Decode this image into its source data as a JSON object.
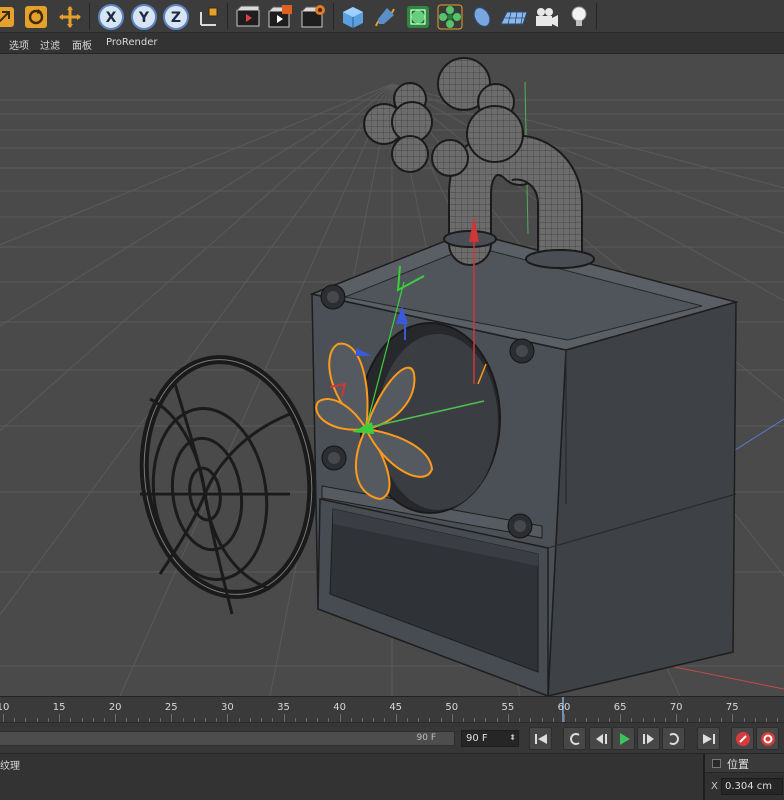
{
  "toolbar": {
    "groups": [
      [
        "scale-tool",
        "rotate-tool",
        "move-tool"
      ],
      [
        "x-axis-lock",
        "y-axis-lock",
        "z-axis-lock",
        "coordinate-system"
      ],
      [
        "render-view",
        "render-to-picture-viewer",
        "render-settings"
      ],
      [
        "cube-primitive",
        "spline-pen",
        "subdivision-surface",
        "cloner",
        "deformer",
        "floor",
        "camera",
        "light"
      ]
    ],
    "axis_labels": {
      "x": "X",
      "y": "Y",
      "z": "Z"
    },
    "colors": {
      "accent": "#f0a030",
      "axis_blue": "#6aa3e8",
      "green": "#3bbf57"
    }
  },
  "menu": {
    "items": [
      "选项",
      "过滤",
      "面板",
      "ProRender"
    ]
  },
  "viewport": {
    "background": "#4a4a4a",
    "grid_color": "#595959",
    "selection_color": "#ff9a1a"
  },
  "timeline": {
    "ruler_labels": [
      "10",
      "15",
      "20",
      "25",
      "30",
      "35",
      "40",
      "45",
      "50",
      "55",
      "60",
      "65",
      "70",
      "75"
    ],
    "current_frame": "60",
    "range_end_value": "90 F",
    "end_frame_value": "90 F",
    "transport_icons": [
      "go-to-start-icon",
      "previous-key-icon",
      "previous-frame-icon",
      "play-icon",
      "next-frame-icon",
      "next-key-icon",
      "go-to-end-icon",
      "record-icon",
      "autokey-icon"
    ]
  },
  "panels": {
    "texture_tab": "纹理",
    "attributes": {
      "section_title": "位置",
      "x_label": "X",
      "x_value": "0.304 cm"
    }
  }
}
